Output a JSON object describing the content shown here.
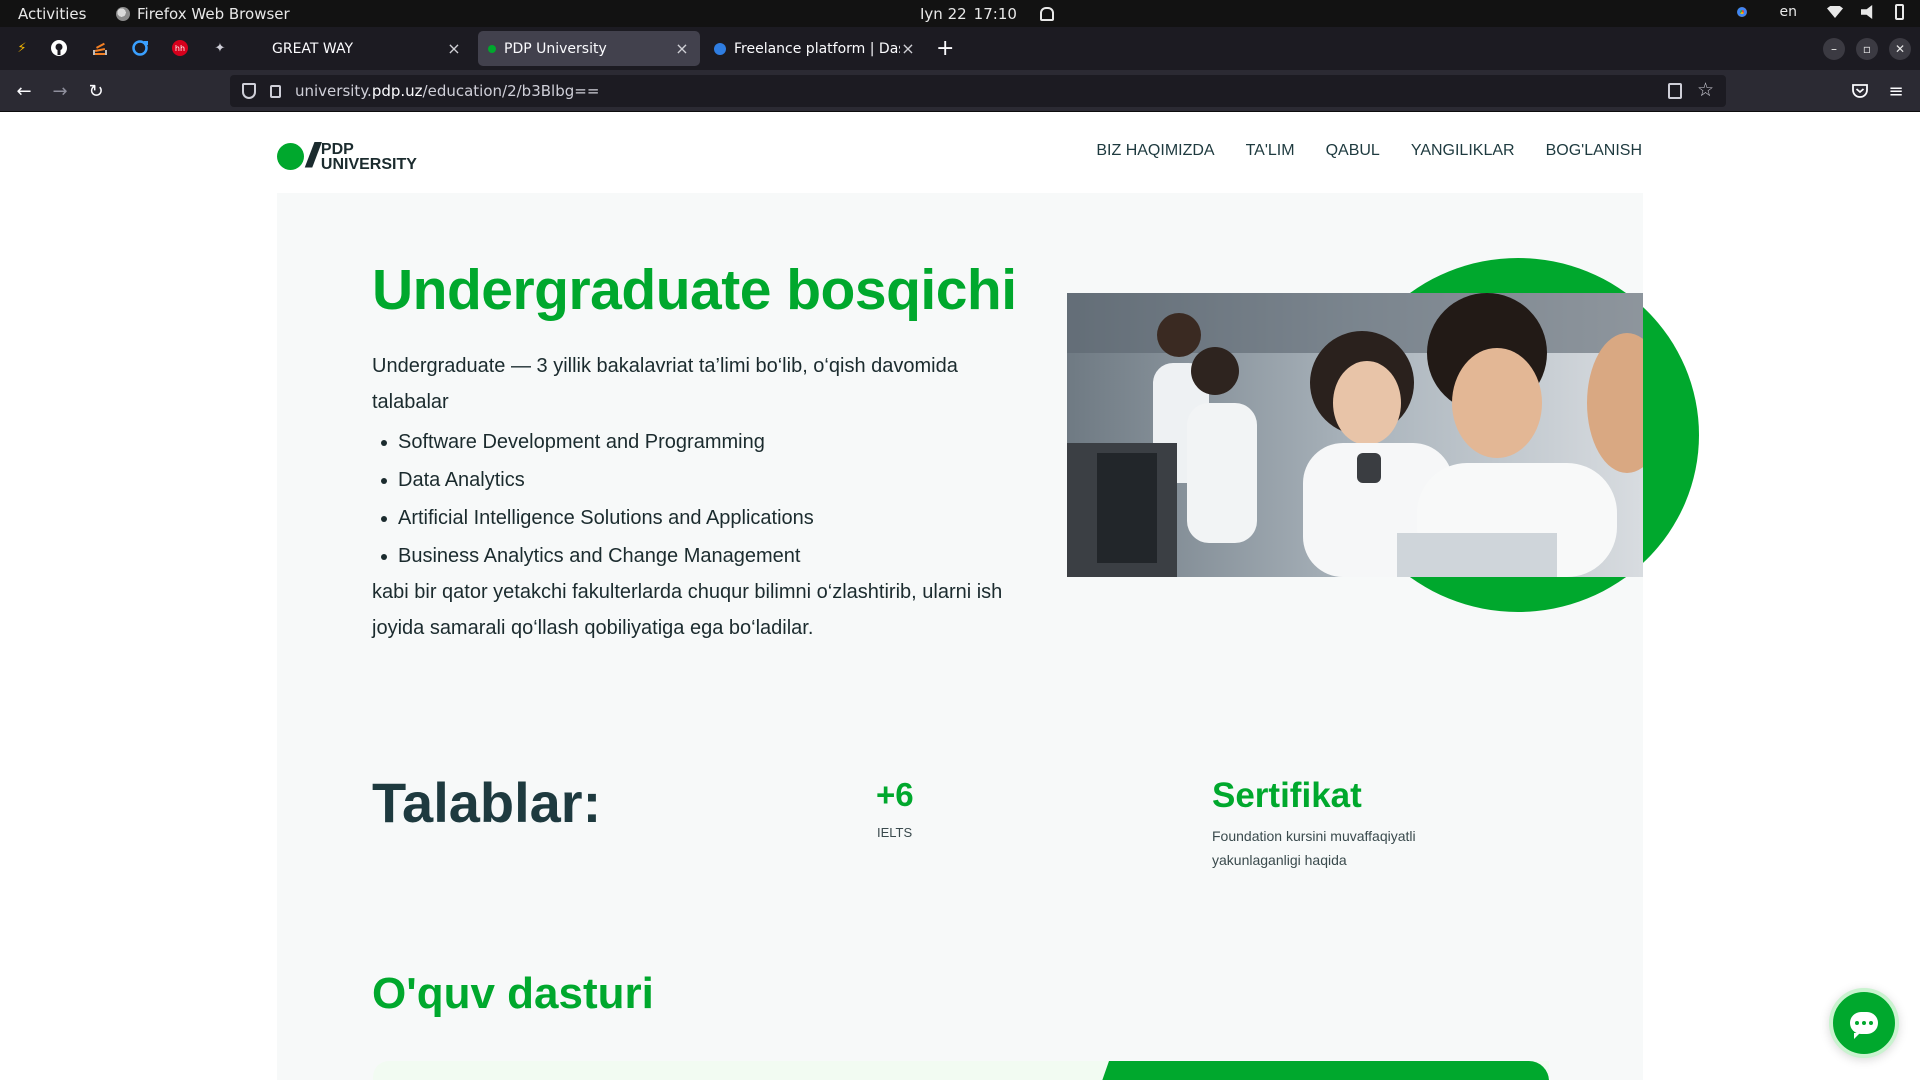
{
  "system_bar": {
    "activities": "Activities",
    "app_name": "Firefox Web Browser",
    "date": "Iyn 22",
    "time": "17:10",
    "language": "en"
  },
  "browser": {
    "tabs": [
      {
        "title": "GREAT WAY",
        "active": false
      },
      {
        "title": "PDP University",
        "active": true
      },
      {
        "title": "Freelance platform | Dash",
        "active": false
      }
    ],
    "new_tab_symbol": "+",
    "close_symbol": "×",
    "url_prefix": "university.",
    "url_domain": "pdp.uz",
    "url_path": "/education/2/b3Blbg=="
  },
  "site": {
    "logo_line1": "PDP",
    "logo_line2": "UNIVERSITY",
    "nav": [
      "BIZ HAQIMIZDA",
      "TA'LIM",
      "QABUL",
      "YANGILIKLAR",
      "BOG'LANISH"
    ]
  },
  "hero": {
    "title": "Undergraduate bosqichi",
    "intro": "Undergraduate — 3 yillik bakalavriat ta’limi bo‘lib, o‘qish davomida talabalar",
    "faculties": [
      "Software Development and Programming",
      "Data Analytics",
      "Artificial Intelligence Solutions and Applications",
      "Business Analytics and Change Management"
    ],
    "outro": "kabi bir qator yetakchi fakulterlarda chuqur bilimni o‘zlashtirib, ularni ish joyida samarali qo‘llash qobiliyatiga ega bo‘ladilar."
  },
  "requirements": {
    "title": "Talablar:",
    "ielts_value": "+6",
    "ielts_label": "IELTS",
    "certificate_title": "Sertifikat",
    "certificate_desc": "Foundation kursini muvaffaqiyatli yakunlaganligi haqida"
  },
  "curriculum": {
    "title": "O'quv dasturi"
  },
  "colors": {
    "brand_green": "#00a82d",
    "dark_text": "#1e3a3f",
    "section_bg": "#f7f9f9"
  }
}
